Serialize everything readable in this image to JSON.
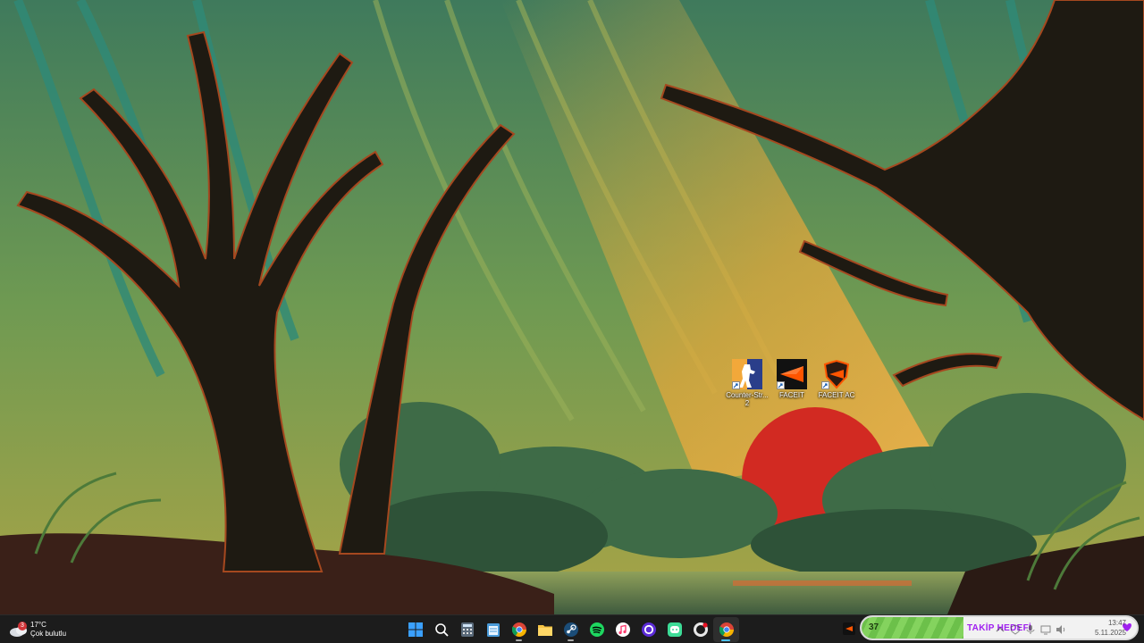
{
  "desktop": {
    "icons": [
      {
        "name": "counter-strike-2",
        "label": "Counter-Str... 2",
        "icon": "counter-strike-icon"
      },
      {
        "name": "faceit",
        "label": "FACEIT",
        "icon": "faceit-icon"
      },
      {
        "name": "faceit-ac",
        "label": "FACEIT AC",
        "icon": "faceit-ac-icon"
      }
    ]
  },
  "taskbar": {
    "weather": {
      "temperature": "17°C",
      "condition": "Çok bulutlu",
      "badge": "3"
    },
    "apps": [
      {
        "name": "start",
        "icon": "windows-logo-icon"
      },
      {
        "name": "search",
        "icon": "search-icon"
      },
      {
        "name": "calculator",
        "icon": "calculator-icon"
      },
      {
        "name": "notepad",
        "icon": "notepad-icon"
      },
      {
        "name": "chrome",
        "icon": "chrome-icon"
      },
      {
        "name": "file-explorer",
        "icon": "folder-icon"
      },
      {
        "name": "steam",
        "icon": "steam-icon"
      },
      {
        "name": "spotify",
        "icon": "spotify-icon"
      },
      {
        "name": "itunes",
        "icon": "music-icon"
      },
      {
        "name": "app-circle",
        "icon": "circle-app-icon"
      },
      {
        "name": "discord",
        "icon": "discord-icon"
      },
      {
        "name": "github-desktop",
        "icon": "github-icon"
      },
      {
        "name": "chrome-active",
        "icon": "chrome-icon"
      }
    ],
    "stream_widget": {
      "count": "37",
      "label": "TAKİP HEDEFİ",
      "progress": 0.37
    },
    "clock": {
      "time": "13:47",
      "date": "5.11.2025"
    }
  },
  "colors": {
    "accent": "#4cc2ff",
    "progress_green": "#6cc04a",
    "label_purple": "#a020f0"
  }
}
